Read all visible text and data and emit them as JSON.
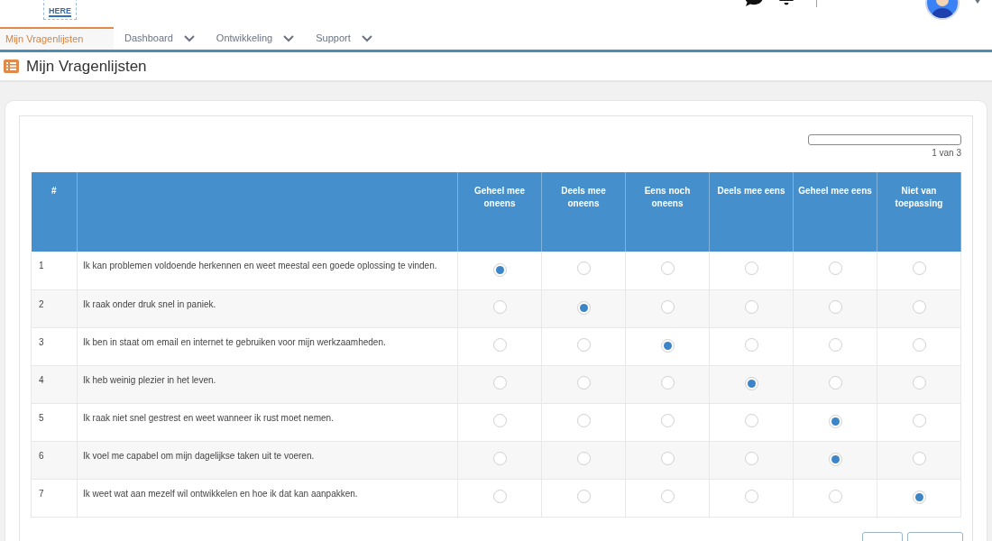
{
  "logo": {
    "text": "HERE"
  },
  "nav": [
    {
      "label": "Mijn Vragenlijsten",
      "selected": true,
      "dropdown": false
    },
    {
      "label": "Dashboard",
      "selected": false,
      "dropdown": true
    },
    {
      "label": "Ontwikkeling",
      "selected": false,
      "dropdown": true
    },
    {
      "label": "Support",
      "selected": false,
      "dropdown": true
    }
  ],
  "page_title": "Mijn Vragenlijsten",
  "progress": {
    "level": 0,
    "label": "1 van 3"
  },
  "table": {
    "columns": [
      "#",
      "",
      "Geheel mee oneens",
      "Deels mee oneens",
      "Eens noch oneens",
      "Deels mee eens",
      "Geheel mee eens",
      "Niet van toepassing"
    ],
    "rows": [
      {
        "number": "1",
        "question": "Ik kan problemen voldoende herkennen en weet meestal een goede oplossing te vinden.",
        "answers": [
          {
            "selected": true
          },
          {
            "selected": false
          },
          {
            "selected": false
          },
          {
            "selected": false
          },
          {
            "selected": false
          },
          {
            "selected": false
          }
        ]
      },
      {
        "number": "2",
        "question": "Ik raak onder druk snel in paniek.",
        "answers": [
          {
            "selected": false
          },
          {
            "selected": true
          },
          {
            "selected": false
          },
          {
            "selected": false
          },
          {
            "selected": false
          },
          {
            "selected": false
          }
        ]
      },
      {
        "number": "3",
        "question": "Ik ben in staat om email en internet te gebruiken voor mijn werkzaamheden.",
        "answers": [
          {
            "selected": false
          },
          {
            "selected": false
          },
          {
            "selected": true
          },
          {
            "selected": false
          },
          {
            "selected": false
          },
          {
            "selected": false
          }
        ]
      },
      {
        "number": "4",
        "question": "Ik heb weinig plezier in het leven.",
        "answers": [
          {
            "selected": false
          },
          {
            "selected": false
          },
          {
            "selected": false
          },
          {
            "selected": true
          },
          {
            "selected": false
          },
          {
            "selected": false
          }
        ]
      },
      {
        "number": "5",
        "question": "Ik raak niet snel gestrest en weet wanneer ik rust moet nemen.",
        "answers": [
          {
            "selected": false
          },
          {
            "selected": false
          },
          {
            "selected": false
          },
          {
            "selected": false
          },
          {
            "selected": true
          },
          {
            "selected": false
          }
        ]
      },
      {
        "number": "6",
        "question": "Ik voel me capabel om mijn dagelijkse taken uit te voeren.",
        "answers": [
          {
            "selected": false
          },
          {
            "selected": false
          },
          {
            "selected": false
          },
          {
            "selected": false
          },
          {
            "selected": true
          },
          {
            "selected": false
          }
        ]
      },
      {
        "number": "7",
        "question": "Ik weet wat aan mezelf wil ontwikkelen en hoe ik dat kan aanpakken.",
        "answers": [
          {
            "selected": false
          },
          {
            "selected": false
          },
          {
            "selected": false
          },
          {
            "selected": false
          },
          {
            "selected": false
          },
          {
            "selected": true
          }
        ]
      }
    ]
  }
}
